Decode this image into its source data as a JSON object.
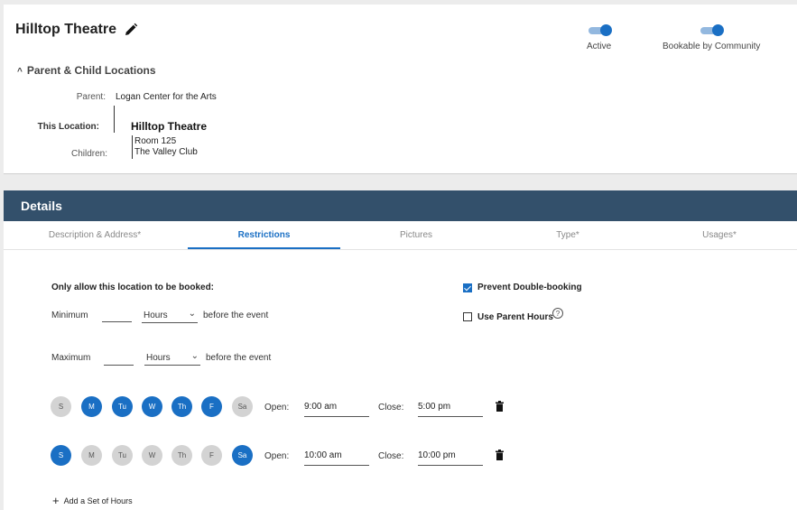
{
  "header": {
    "title": "Hilltop Theatre",
    "toggles": [
      {
        "label": "Active",
        "on": true
      },
      {
        "label": "Bookable by Community",
        "on": true
      }
    ],
    "section_title": "Parent & Child Locations",
    "parent_label": "Parent:",
    "parent_value": "Logan Center for the Arts",
    "this_label": "This Location:",
    "this_value": "Hilltop Theatre",
    "children_label": "Children:",
    "children": [
      "Room 125",
      "The Valley Club"
    ]
  },
  "details": {
    "title": "Details",
    "tabs": [
      {
        "label": "Description & Address*",
        "active": false
      },
      {
        "label": "Restrictions",
        "active": true
      },
      {
        "label": "Pictures",
        "active": false
      },
      {
        "label": "Type*",
        "active": false
      },
      {
        "label": "Usages*",
        "active": false
      }
    ]
  },
  "restrictions": {
    "booking_heading": "Only allow this location to be booked:",
    "minimum_label": "Minimum",
    "minimum_value": "",
    "minimum_unit": "Hours",
    "maximum_label": "Maximum",
    "maximum_value": "",
    "maximum_unit": "Hours",
    "before_event": "before the event",
    "prevent_double_booking": {
      "label": "Prevent Double-booking",
      "checked": true
    },
    "use_parent_hours": {
      "label": "Use Parent Hours",
      "checked": false
    },
    "hour_sets": [
      {
        "days": [
          {
            "label": "S",
            "on": false
          },
          {
            "label": "M",
            "on": true
          },
          {
            "label": "Tu",
            "on": true
          },
          {
            "label": "W",
            "on": true
          },
          {
            "label": "Th",
            "on": true
          },
          {
            "label": "F",
            "on": true
          },
          {
            "label": "Sa",
            "on": false
          }
        ],
        "open_label": "Open:",
        "open": "9:00 am",
        "close_label": "Close:",
        "close": "5:00 pm"
      },
      {
        "days": [
          {
            "label": "S",
            "on": true
          },
          {
            "label": "M",
            "on": false
          },
          {
            "label": "Tu",
            "on": false
          },
          {
            "label": "W",
            "on": false
          },
          {
            "label": "Th",
            "on": false
          },
          {
            "label": "F",
            "on": false
          },
          {
            "label": "Sa",
            "on": true
          }
        ],
        "open_label": "Open:",
        "open": "10:00 am",
        "close_label": "Close:",
        "close": "10:00 pm"
      }
    ],
    "add_hours_label": "Add a Set of Hours"
  },
  "colors": {
    "accent": "#1a6fc4",
    "header_bar": "#33506b"
  }
}
